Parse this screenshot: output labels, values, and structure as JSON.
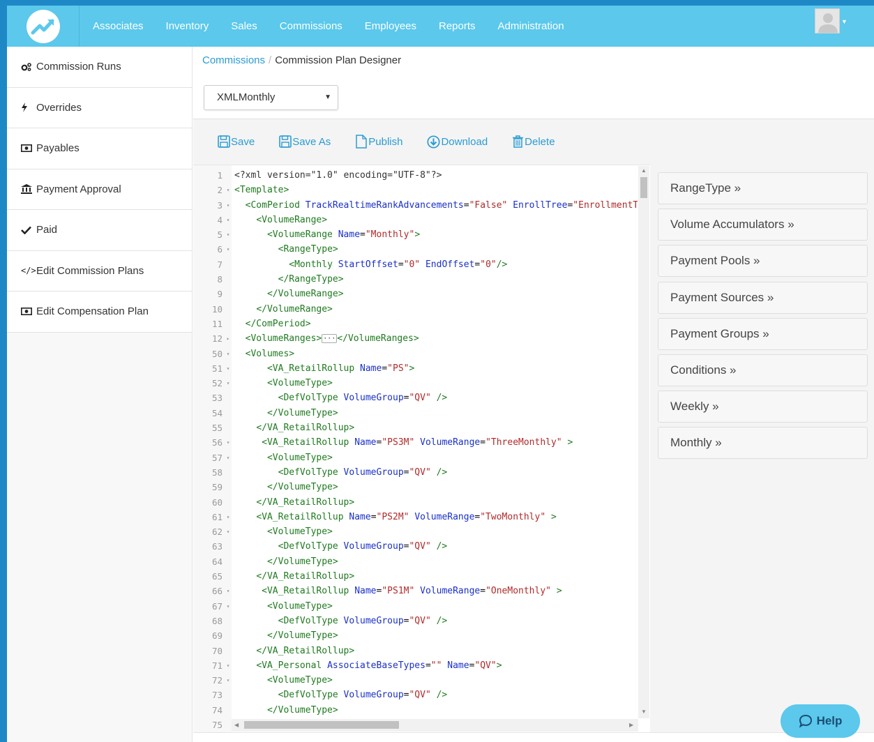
{
  "nav": {
    "links": [
      "Associates",
      "Inventory",
      "Sales",
      "Commissions",
      "Employees",
      "Reports",
      "Administration"
    ]
  },
  "colors": {
    "nav_bg": "#5bc8ec",
    "frame": "#1e88c7",
    "link": "#2a9bd3"
  },
  "sidebar": {
    "items": [
      {
        "label": "Commission Runs",
        "icon": "cogs-icon"
      },
      {
        "label": "Overrides",
        "icon": "bolt-icon"
      },
      {
        "label": "Payables",
        "icon": "money-icon"
      },
      {
        "label": "Payment Approval",
        "icon": "bank-icon"
      },
      {
        "label": "Paid",
        "icon": "check-icon"
      },
      {
        "label": "Edit Commission Plans",
        "icon": "code-icon"
      },
      {
        "label": "Edit Compensation Plan",
        "icon": "money-icon"
      }
    ]
  },
  "breadcrumb": {
    "parent": "Commissions",
    "separator": "/",
    "current": "Commission Plan Designer"
  },
  "plan_select": {
    "value": "XMLMonthly"
  },
  "toolbar": {
    "save": "Save",
    "save_as": "Save As",
    "publish": "Publish",
    "download": "Download",
    "delete": "Delete"
  },
  "editor": {
    "lines": [
      {
        "n": "1",
        "f": "",
        "segs": [
          [
            "t",
            "<?xml version=\"1.0\" encoding=\"UTF-8\"?>"
          ]
        ],
        "plain": true
      },
      {
        "n": "2",
        "f": "▾",
        "segs": [
          [
            "t",
            "<Template>"
          ]
        ]
      },
      {
        "n": "3",
        "f": "▾",
        "segs": [
          [
            "s",
            "  "
          ],
          [
            "t",
            "<ComPeriod "
          ],
          [
            "a",
            "TrackRealtimeRankAdvancements"
          ],
          [
            "s",
            "="
          ],
          [
            "v",
            "\"False\""
          ],
          [
            "s",
            " "
          ],
          [
            "a",
            "EnrollTree"
          ],
          [
            "s",
            "="
          ],
          [
            "v",
            "\"EnrollmentTree\""
          ]
        ]
      },
      {
        "n": "4",
        "f": "▾",
        "segs": [
          [
            "s",
            "    "
          ],
          [
            "t",
            "<VolumeRange>"
          ]
        ]
      },
      {
        "n": "5",
        "f": "▾",
        "segs": [
          [
            "s",
            "      "
          ],
          [
            "t",
            "<VolumeRange "
          ],
          [
            "a",
            "Name"
          ],
          [
            "s",
            "="
          ],
          [
            "v",
            "\"Monthly\""
          ],
          [
            "t",
            ">"
          ]
        ]
      },
      {
        "n": "6",
        "f": "▾",
        "segs": [
          [
            "s",
            "        "
          ],
          [
            "t",
            "<RangeType>"
          ]
        ]
      },
      {
        "n": "7",
        "f": "",
        "segs": [
          [
            "s",
            "          "
          ],
          [
            "t",
            "<Monthly "
          ],
          [
            "a",
            "StartOffset"
          ],
          [
            "s",
            "="
          ],
          [
            "v",
            "\"0\""
          ],
          [
            "s",
            " "
          ],
          [
            "a",
            "EndOffset"
          ],
          [
            "s",
            "="
          ],
          [
            "v",
            "\"0\""
          ],
          [
            "t",
            "/>"
          ]
        ]
      },
      {
        "n": "8",
        "f": "",
        "segs": [
          [
            "s",
            "        "
          ],
          [
            "t",
            "</RangeType>"
          ]
        ]
      },
      {
        "n": "9",
        "f": "",
        "segs": [
          [
            "s",
            "      "
          ],
          [
            "t",
            "</VolumeRange>"
          ]
        ]
      },
      {
        "n": "10",
        "f": "",
        "segs": [
          [
            "s",
            "    "
          ],
          [
            "t",
            "</VolumeRange>"
          ]
        ]
      },
      {
        "n": "11",
        "f": "",
        "segs": [
          [
            "s",
            "  "
          ],
          [
            "t",
            "</ComPeriod>"
          ]
        ]
      },
      {
        "n": "12",
        "f": "▸",
        "segs": [
          [
            "s",
            "  "
          ],
          [
            "t",
            "<VolumeRanges>"
          ],
          [
            "c",
            "···"
          ],
          [
            "t",
            "</VolumeRanges>"
          ]
        ]
      },
      {
        "n": "50",
        "f": "▾",
        "segs": [
          [
            "s",
            "  "
          ],
          [
            "t",
            "<Volumes>"
          ]
        ]
      },
      {
        "n": "51",
        "f": "▾",
        "segs": [
          [
            "s",
            "      "
          ],
          [
            "t",
            "<VA_RetailRollup "
          ],
          [
            "a",
            "Name"
          ],
          [
            "s",
            "="
          ],
          [
            "v",
            "\"PS\""
          ],
          [
            "t",
            ">"
          ]
        ]
      },
      {
        "n": "52",
        "f": "▾",
        "segs": [
          [
            "s",
            "      "
          ],
          [
            "t",
            "<VolumeType>"
          ]
        ]
      },
      {
        "n": "53",
        "f": "",
        "segs": [
          [
            "s",
            "        "
          ],
          [
            "t",
            "<DefVolType "
          ],
          [
            "a",
            "VolumeGroup"
          ],
          [
            "s",
            "="
          ],
          [
            "v",
            "\"QV\""
          ],
          [
            "s",
            " "
          ],
          [
            "t",
            "/>"
          ]
        ]
      },
      {
        "n": "54",
        "f": "",
        "segs": [
          [
            "s",
            "      "
          ],
          [
            "t",
            "</VolumeType>"
          ]
        ]
      },
      {
        "n": "55",
        "f": "",
        "segs": [
          [
            "s",
            "    "
          ],
          [
            "t",
            "</VA_RetailRollup>"
          ]
        ]
      },
      {
        "n": "56",
        "f": "▾",
        "segs": [
          [
            "s",
            "     "
          ],
          [
            "t",
            "<VA_RetailRollup "
          ],
          [
            "a",
            "Name"
          ],
          [
            "s",
            "="
          ],
          [
            "v",
            "\"PS3M\""
          ],
          [
            "s",
            " "
          ],
          [
            "a",
            "VolumeRange"
          ],
          [
            "s",
            "="
          ],
          [
            "v",
            "\"ThreeMonthly\""
          ],
          [
            "s",
            " "
          ],
          [
            "t",
            ">"
          ]
        ]
      },
      {
        "n": "57",
        "f": "▾",
        "segs": [
          [
            "s",
            "      "
          ],
          [
            "t",
            "<VolumeType>"
          ]
        ]
      },
      {
        "n": "58",
        "f": "",
        "segs": [
          [
            "s",
            "        "
          ],
          [
            "t",
            "<DefVolType "
          ],
          [
            "a",
            "VolumeGroup"
          ],
          [
            "s",
            "="
          ],
          [
            "v",
            "\"QV\""
          ],
          [
            "s",
            " "
          ],
          [
            "t",
            "/>"
          ]
        ]
      },
      {
        "n": "59",
        "f": "",
        "segs": [
          [
            "s",
            "      "
          ],
          [
            "t",
            "</VolumeType>"
          ]
        ]
      },
      {
        "n": "60",
        "f": "",
        "segs": [
          [
            "s",
            "    "
          ],
          [
            "t",
            "</VA_RetailRollup>"
          ]
        ]
      },
      {
        "n": "61",
        "f": "▾",
        "segs": [
          [
            "s",
            "    "
          ],
          [
            "t",
            "<VA_RetailRollup "
          ],
          [
            "a",
            "Name"
          ],
          [
            "s",
            "="
          ],
          [
            "v",
            "\"PS2M\""
          ],
          [
            "s",
            " "
          ],
          [
            "a",
            "VolumeRange"
          ],
          [
            "s",
            "="
          ],
          [
            "v",
            "\"TwoMonthly\""
          ],
          [
            "s",
            " "
          ],
          [
            "t",
            ">"
          ]
        ]
      },
      {
        "n": "62",
        "f": "▾",
        "segs": [
          [
            "s",
            "      "
          ],
          [
            "t",
            "<VolumeType>"
          ]
        ]
      },
      {
        "n": "63",
        "f": "",
        "segs": [
          [
            "s",
            "        "
          ],
          [
            "t",
            "<DefVolType "
          ],
          [
            "a",
            "VolumeGroup"
          ],
          [
            "s",
            "="
          ],
          [
            "v",
            "\"QV\""
          ],
          [
            "s",
            " "
          ],
          [
            "t",
            "/>"
          ]
        ]
      },
      {
        "n": "64",
        "f": "",
        "segs": [
          [
            "s",
            "      "
          ],
          [
            "t",
            "</VolumeType>"
          ]
        ]
      },
      {
        "n": "65",
        "f": "",
        "segs": [
          [
            "s",
            "    "
          ],
          [
            "t",
            "</VA_RetailRollup>"
          ]
        ]
      },
      {
        "n": "66",
        "f": "▾",
        "segs": [
          [
            "s",
            "     "
          ],
          [
            "t",
            "<VA_RetailRollup "
          ],
          [
            "a",
            "Name"
          ],
          [
            "s",
            "="
          ],
          [
            "v",
            "\"PS1M\""
          ],
          [
            "s",
            " "
          ],
          [
            "a",
            "VolumeRange"
          ],
          [
            "s",
            "="
          ],
          [
            "v",
            "\"OneMonthly\""
          ],
          [
            "s",
            " "
          ],
          [
            "t",
            ">"
          ]
        ]
      },
      {
        "n": "67",
        "f": "▾",
        "segs": [
          [
            "s",
            "      "
          ],
          [
            "t",
            "<VolumeType>"
          ]
        ]
      },
      {
        "n": "68",
        "f": "",
        "segs": [
          [
            "s",
            "        "
          ],
          [
            "t",
            "<DefVolType "
          ],
          [
            "a",
            "VolumeGroup"
          ],
          [
            "s",
            "="
          ],
          [
            "v",
            "\"QV\""
          ],
          [
            "s",
            " "
          ],
          [
            "t",
            "/>"
          ]
        ]
      },
      {
        "n": "69",
        "f": "",
        "segs": [
          [
            "s",
            "      "
          ],
          [
            "t",
            "</VolumeType>"
          ]
        ]
      },
      {
        "n": "70",
        "f": "",
        "segs": [
          [
            "s",
            "    "
          ],
          [
            "t",
            "</VA_RetailRollup>"
          ]
        ]
      },
      {
        "n": "71",
        "f": "▾",
        "segs": [
          [
            "s",
            "    "
          ],
          [
            "t",
            "<VA_Personal "
          ],
          [
            "a",
            "AssociateBaseTypes"
          ],
          [
            "s",
            "="
          ],
          [
            "v",
            "\"\""
          ],
          [
            "s",
            " "
          ],
          [
            "a",
            "Name"
          ],
          [
            "s",
            "="
          ],
          [
            "v",
            "\"QV\""
          ],
          [
            "t",
            ">"
          ]
        ]
      },
      {
        "n": "72",
        "f": "▾",
        "segs": [
          [
            "s",
            "      "
          ],
          [
            "t",
            "<VolumeType>"
          ]
        ]
      },
      {
        "n": "73",
        "f": "",
        "segs": [
          [
            "s",
            "        "
          ],
          [
            "t",
            "<DefVolType "
          ],
          [
            "a",
            "VolumeGroup"
          ],
          [
            "s",
            "="
          ],
          [
            "v",
            "\"QV\""
          ],
          [
            "s",
            " "
          ],
          [
            "t",
            "/>"
          ]
        ]
      },
      {
        "n": "74",
        "f": "",
        "segs": [
          [
            "s",
            "      "
          ],
          [
            "t",
            "</VolumeType>"
          ]
        ]
      },
      {
        "n": "75",
        "f": "",
        "segs": []
      }
    ]
  },
  "right_panel": {
    "buttons": [
      "RangeType »",
      "Volume Accumulators »",
      "Payment Pools »",
      "Payment Sources »",
      "Payment Groups »",
      "Conditions »",
      "Weekly »",
      "Monthly »"
    ]
  },
  "help": {
    "label": "Help"
  }
}
